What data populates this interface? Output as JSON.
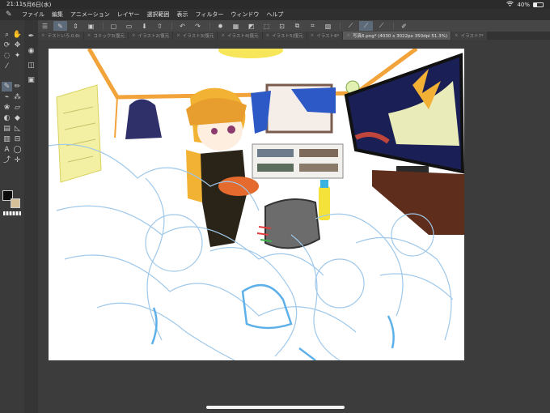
{
  "status": {
    "time": "21:11",
    "date": "5月6日(水)",
    "wifi_icon": "wifi-icon",
    "battery": "40%",
    "battery_fraction": 0.4
  },
  "menu": {
    "items": [
      "ファイル",
      "編集",
      "アニメーション",
      "レイヤー",
      "選択範囲",
      "表示",
      "フィルター",
      "ウィンドウ",
      "ヘルプ"
    ]
  },
  "tabs": [
    {
      "label": "テストいろ.0.6t",
      "active": false
    },
    {
      "label": "コミック3(復元",
      "active": false
    },
    {
      "label": "イラスト2(復元",
      "active": false
    },
    {
      "label": "イラスト3(復元",
      "active": false
    },
    {
      "label": "イラスト4(復元",
      "active": false
    },
    {
      "label": "イラスト5(復元",
      "active": false
    },
    {
      "label": "イラスト6*",
      "active": false
    },
    {
      "label": "写真6.png* (4030 x 3022px 350dpi 51.3%)",
      "active": true
    },
    {
      "label": "イラスト7*",
      "active": false
    }
  ],
  "colors": {
    "main": "#0a0a0a",
    "sub": "#d6c09a",
    "accent": "#5d6a7a"
  }
}
